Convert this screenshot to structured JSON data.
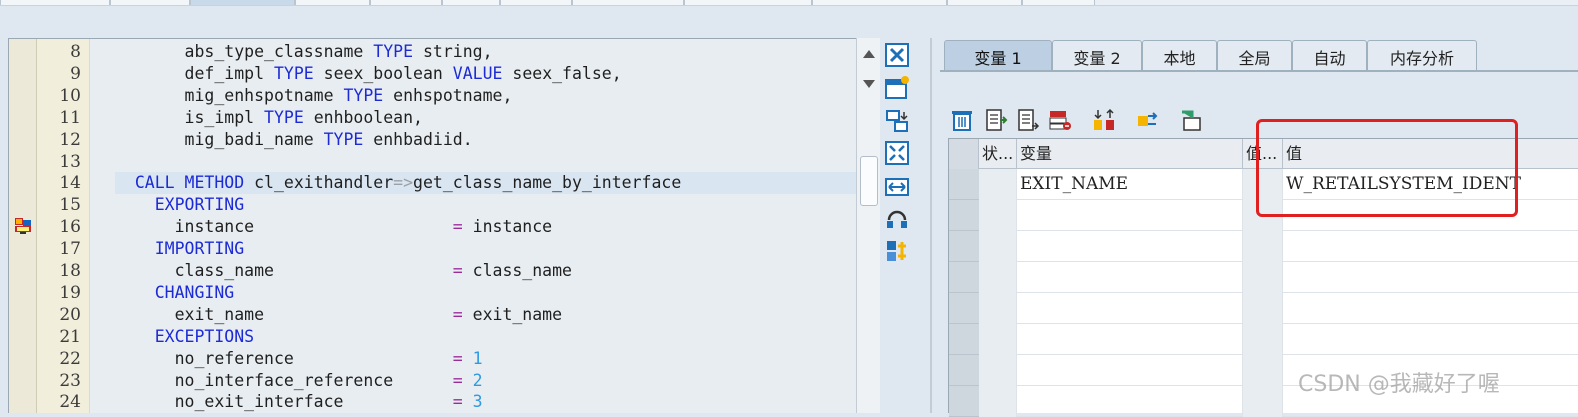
{
  "editor": {
    "lines": [
      {
        "no": "8",
        "html": "       abs_type_classname <span class=\"kw\">TYPE</span> string,"
      },
      {
        "no": "9",
        "html": "       def_impl <span class=\"kw\">TYPE</span> seex_boolean <span class=\"kw\">VALUE</span> seex_false,"
      },
      {
        "no": "10",
        "html": "       mig_enhspotname <span class=\"kw\">TYPE</span> enhspotname,"
      },
      {
        "no": "11",
        "html": "       is_impl <span class=\"kw\">TYPE</span> enhboolean,"
      },
      {
        "no": "12",
        "html": "       mig_badi_name <span class=\"kw\">TYPE</span> enhbadiid."
      },
      {
        "no": "13",
        "html": ""
      },
      {
        "no": "14",
        "html": "  <span class=\"kw\">CALL METHOD</span> cl_exithandler<span class=\"arrow\">=&gt;</span>get_class_name_by_interface",
        "current": true
      },
      {
        "no": "15",
        "html": "    <span class=\"kw\">EXPORTING</span>"
      },
      {
        "no": "16",
        "html": "      instance                    <span class=\"eq\">=</span> instance"
      },
      {
        "no": "17",
        "html": "    <span class=\"kw\">IMPORTING</span>"
      },
      {
        "no": "18",
        "html": "      class_name                  <span class=\"eq\">=</span> class_name"
      },
      {
        "no": "19",
        "html": "    <span class=\"kw\">CHANGING</span>"
      },
      {
        "no": "20",
        "html": "      exit_name                   <span class=\"eq\">=</span> exit_name"
      },
      {
        "no": "21",
        "html": "    <span class=\"kw\">EXCEPTIONS</span>"
      },
      {
        "no": "22",
        "html": "      no_reference                <span class=\"eq\">=</span> <span class=\"num\">1</span>"
      },
      {
        "no": "23",
        "html": "      no_interface_reference      <span class=\"eq\">=</span> <span class=\"num\">2</span>"
      },
      {
        "no": "24",
        "html": "      no_exit_interface           <span class=\"eq\">=</span> <span class=\"num\">3</span>"
      }
    ]
  },
  "debugger": {
    "tabs": [
      "变量 1",
      "变量 2",
      "本地",
      "全局",
      "自动",
      "内存分析"
    ],
    "active_tab": 0,
    "columns": {
      "status": "状...",
      "variable": "变量",
      "val_short": "值...",
      "value": "值"
    },
    "rows": [
      {
        "variable": "EXIT_NAME",
        "value": "W_RETAILSYSTEM_IDENT"
      },
      {
        "variable": "",
        "value": ""
      },
      {
        "variable": "",
        "value": ""
      },
      {
        "variable": "",
        "value": ""
      },
      {
        "variable": "",
        "value": ""
      },
      {
        "variable": "",
        "value": ""
      },
      {
        "variable": "",
        "value": ""
      },
      {
        "variable": "",
        "value": ""
      }
    ]
  },
  "watermark": "CSDN @我藏好了喔",
  "colors": {
    "keyword": "#1c2bd6",
    "number": "#2f9ae0",
    "highlight_box": "#e02020"
  }
}
